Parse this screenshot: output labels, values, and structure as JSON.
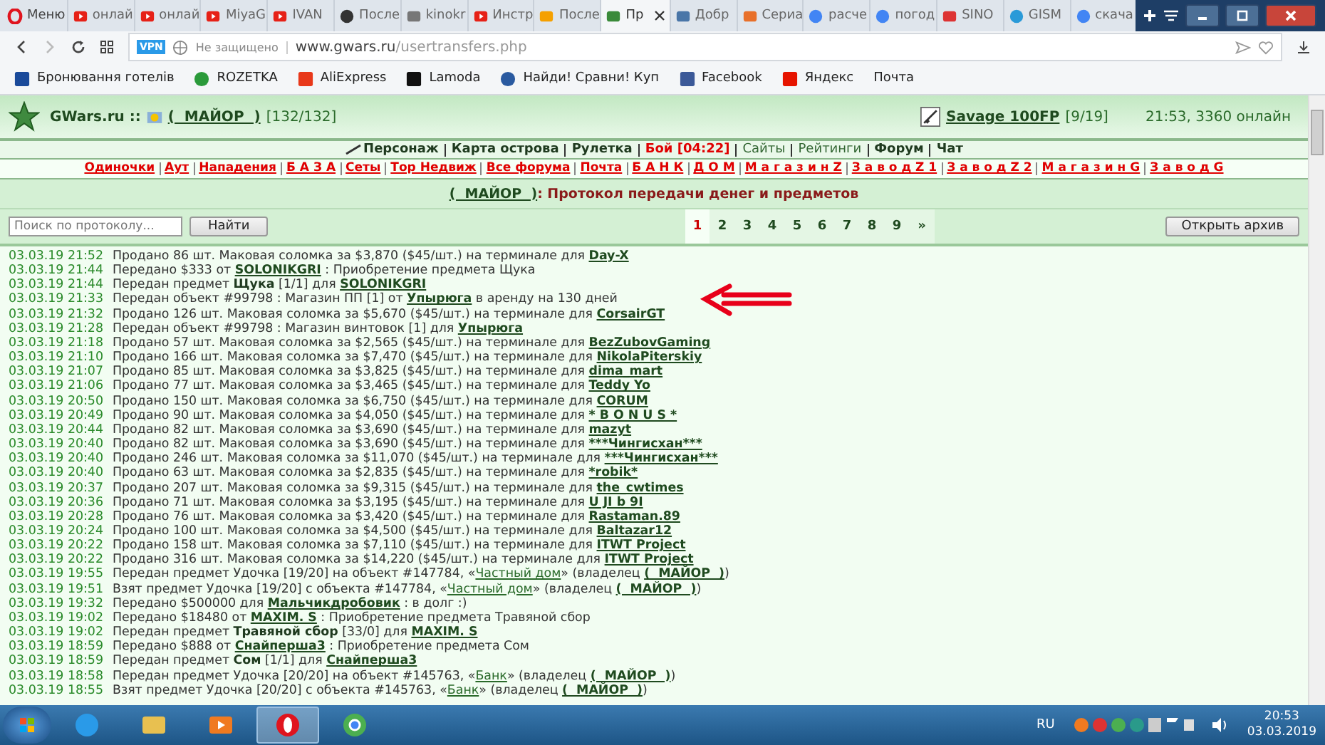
{
  "browser": {
    "menu": "Меню",
    "tabs": [
      {
        "label": "онлай",
        "selected": false
      },
      {
        "label": "онлай",
        "selected": false
      },
      {
        "label": "MiyaG",
        "selected": false
      },
      {
        "label": "IVAN",
        "selected": false
      },
      {
        "label": "После",
        "selected": false
      },
      {
        "label": "kinokr",
        "selected": false
      },
      {
        "label": "Инстр",
        "selected": false
      },
      {
        "label": "После",
        "selected": false
      },
      {
        "label": "Пр",
        "selected": true
      },
      {
        "label": "Добр",
        "selected": false
      },
      {
        "label": "Сериа",
        "selected": false
      },
      {
        "label": "расче",
        "selected": false
      },
      {
        "label": "погод",
        "selected": false
      },
      {
        "label": "SINO",
        "selected": false
      },
      {
        "label": "GISM",
        "selected": false
      },
      {
        "label": "скача",
        "selected": false
      }
    ],
    "vpn": "VPN",
    "security": "Не защищено",
    "url_host": "www.gwars.ru",
    "url_path": "/usertransfers.php",
    "bookmarks": [
      "Бронювання готелів",
      "ROZETKA",
      "AliExpress",
      "Lamoda",
      "Найди! Сравни! Куп",
      "Facebook",
      "Яндекс",
      "Почта"
    ]
  },
  "header": {
    "site": "GWars.ru ::",
    "player": "(  МАЙОР  )",
    "hp": "[132/132]",
    "weapon": "Savage 100FP",
    "ammo": "[9/19]",
    "status": "21:53, 3360 онлайн"
  },
  "nav": [
    {
      "label": "Персонаж",
      "kind": "bold"
    },
    {
      "label": "Карта острова",
      "kind": "bold"
    },
    {
      "label": "Рулетка",
      "kind": "bold"
    },
    {
      "label": "Бой [04:22]",
      "kind": "alert"
    },
    {
      "label": "Сайты",
      "kind": "plain"
    },
    {
      "label": "Рейтинги",
      "kind": "plain"
    },
    {
      "label": "Форум",
      "kind": "bold"
    },
    {
      "label": "Чат",
      "kind": "bold"
    }
  ],
  "subnav": [
    "Одиночки",
    "Аут",
    "Нападения",
    "Б А З А",
    "Сеты",
    "Тор Недвиж",
    "Все форума",
    "Почта",
    "Б А Н К",
    "Д О М",
    "М а г а з и н Z",
    "З а в о д Z 1",
    "З а в о д Z 2",
    "М а г а з и н G",
    "З а в о д G"
  ],
  "title": {
    "player": "(  МАЙОР  )",
    "text": ": Протокол передачи денег и предметов"
  },
  "search": {
    "placeholder": "Поиск по протоколу...",
    "button": "Найти"
  },
  "pages": [
    {
      "label": "1",
      "selected": true
    },
    {
      "label": "2",
      "selected": false
    },
    {
      "label": "3",
      "selected": false
    },
    {
      "label": "4",
      "selected": false
    },
    {
      "label": "5",
      "selected": false
    },
    {
      "label": "6",
      "selected": false
    },
    {
      "label": "7",
      "selected": false
    },
    {
      "label": "8",
      "selected": false
    },
    {
      "label": "9",
      "selected": false
    },
    {
      "label": "»",
      "selected": false
    }
  ],
  "archive_button": "Открыть архив",
  "log": [
    {
      "date": "03.03.19 21:52",
      "parts": [
        {
          "kind": "text",
          "text": "Продано 86 шт. Маковая соломка за $3,870 ($45/шт.) на терминале для "
        },
        {
          "kind": "link",
          "text": "Day-X"
        }
      ]
    },
    {
      "date": "03.03.19 21:44",
      "parts": [
        {
          "kind": "text",
          "text": "Передано $333 от "
        },
        {
          "kind": "link",
          "text": "SOLONIKGRI"
        },
        {
          "kind": "text",
          "text": " : Приобретение предмета Щука"
        }
      ]
    },
    {
      "date": "03.03.19 21:44",
      "parts": [
        {
          "kind": "text",
          "text": "Передан предмет "
        },
        {
          "kind": "bold",
          "text": "Щука"
        },
        {
          "kind": "text",
          "text": " [1/1] для "
        },
        {
          "kind": "link",
          "text": "SOLONIKGRI"
        }
      ]
    },
    {
      "date": "03.03.19 21:33",
      "parts": [
        {
          "kind": "text",
          "text": "Передан объект #99798 : Магазин ПП [1] от "
        },
        {
          "kind": "link",
          "text": "Упырюга"
        },
        {
          "kind": "text",
          "text": " в аренду на 130 дней"
        }
      ]
    },
    {
      "date": "03.03.19 21:32",
      "parts": [
        {
          "kind": "text",
          "text": "Продано 126 шт. Маковая соломка за $5,670 ($45/шт.) на терминале для "
        },
        {
          "kind": "link",
          "text": "CorsairGT"
        }
      ]
    },
    {
      "date": "03.03.19 21:28",
      "parts": [
        {
          "kind": "text",
          "text": "Передан объект #99798 : Магазин винтовок [1] для "
        },
        {
          "kind": "link",
          "text": "Упырюга"
        }
      ]
    },
    {
      "date": "03.03.19 21:18",
      "parts": [
        {
          "kind": "text",
          "text": "Продано 57 шт. Маковая соломка за $2,565 ($45/шт.) на терминале для "
        },
        {
          "kind": "link",
          "text": "BezZubovGaming"
        }
      ]
    },
    {
      "date": "03.03.19 21:10",
      "parts": [
        {
          "kind": "text",
          "text": "Продано 166 шт. Маковая соломка за $7,470 ($45/шт.) на терминале для "
        },
        {
          "kind": "link",
          "text": "NikolaPiterskiy"
        }
      ]
    },
    {
      "date": "03.03.19 21:07",
      "parts": [
        {
          "kind": "text",
          "text": "Продано 85 шт. Маковая соломка за $3,825 ($45/шт.) на терминале для "
        },
        {
          "kind": "link",
          "text": "dima_mart"
        }
      ]
    },
    {
      "date": "03.03.19 21:06",
      "parts": [
        {
          "kind": "text",
          "text": "Продано 77 шт. Маковая соломка за $3,465 ($45/шт.) на терминале для "
        },
        {
          "kind": "link",
          "text": "Teddy Yo"
        }
      ]
    },
    {
      "date": "03.03.19 20:50",
      "parts": [
        {
          "kind": "text",
          "text": "Продано 150 шт. Маковая соломка за $6,750 ($45/шт.) на терминале для "
        },
        {
          "kind": "link",
          "text": "CORUM"
        }
      ]
    },
    {
      "date": "03.03.19 20:49",
      "parts": [
        {
          "kind": "text",
          "text": "Продано 90 шт. Маковая соломка за $4,050 ($45/шт.) на терминале для "
        },
        {
          "kind": "link",
          "text": "* B O N U S *"
        }
      ]
    },
    {
      "date": "03.03.19 20:44",
      "parts": [
        {
          "kind": "text",
          "text": "Продано 82 шт. Маковая соломка за $3,690 ($45/шт.) на терминале для "
        },
        {
          "kind": "link",
          "text": "mazyt"
        }
      ]
    },
    {
      "date": "03.03.19 20:40",
      "parts": [
        {
          "kind": "text",
          "text": "Продано 82 шт. Маковая соломка за $3,690 ($45/шт.) на терминале для "
        },
        {
          "kind": "link",
          "text": "***Чингисхан***"
        }
      ]
    },
    {
      "date": "03.03.19 20:40",
      "parts": [
        {
          "kind": "text",
          "text": "Продано 246 шт. Маковая соломка за $11,070 ($45/шт.) на терминале для "
        },
        {
          "kind": "link",
          "text": "***Чингисхан***"
        }
      ]
    },
    {
      "date": "03.03.19 20:40",
      "parts": [
        {
          "kind": "text",
          "text": "Продано 63 шт. Маковая соломка за $2,835 ($45/шт.) на терминале для "
        },
        {
          "kind": "link",
          "text": "*robik*"
        }
      ]
    },
    {
      "date": "03.03.19 20:37",
      "parts": [
        {
          "kind": "text",
          "text": "Продано 207 шт. Маковая соломка за $9,315 ($45/шт.) на терминале для "
        },
        {
          "kind": "link",
          "text": "the_cwtimes"
        }
      ]
    },
    {
      "date": "03.03.19 20:36",
      "parts": [
        {
          "kind": "text",
          "text": "Продано 71 шт. Маковая соломка за $3,195 ($45/шт.) на терминале для "
        },
        {
          "kind": "link",
          "text": "U JI b 9I"
        }
      ]
    },
    {
      "date": "03.03.19 20:28",
      "parts": [
        {
          "kind": "text",
          "text": "Продано 76 шт. Маковая соломка за $3,420 ($45/шт.) на терминале для "
        },
        {
          "kind": "link",
          "text": "Rastaman.89"
        }
      ]
    },
    {
      "date": "03.03.19 20:24",
      "parts": [
        {
          "kind": "text",
          "text": "Продано 100 шт. Маковая соломка за $4,500 ($45/шт.) на терминале для "
        },
        {
          "kind": "link",
          "text": "Baltazar12"
        }
      ]
    },
    {
      "date": "03.03.19 20:22",
      "parts": [
        {
          "kind": "text",
          "text": "Продано 158 шт. Маковая соломка за $7,110 ($45/шт.) на терминале для "
        },
        {
          "kind": "link",
          "text": "ITWT Project"
        }
      ]
    },
    {
      "date": "03.03.19 20:22",
      "parts": [
        {
          "kind": "text",
          "text": "Продано 316 шт. Маковая соломка за $14,220 ($45/шт.) на терминале для "
        },
        {
          "kind": "link",
          "text": "ITWT Project"
        }
      ]
    },
    {
      "date": "03.03.19 19:55",
      "parts": [
        {
          "kind": "text",
          "text": "Передан предмет Удочка [19/20] на объект #147784, «"
        },
        {
          "kind": "object",
          "text": "Частный дом"
        },
        {
          "kind": "text",
          "text": "» (владелец "
        },
        {
          "kind": "link",
          "text": "(  МАЙОР  )"
        },
        {
          "kind": "text",
          "text": ")"
        }
      ]
    },
    {
      "date": "03.03.19 19:51",
      "parts": [
        {
          "kind": "text",
          "text": "Взят предмет Удочка [19/20] с объекта #147784, «"
        },
        {
          "kind": "object",
          "text": "Частный дом"
        },
        {
          "kind": "text",
          "text": "» (владелец "
        },
        {
          "kind": "link",
          "text": "(  МАЙОР  )"
        },
        {
          "kind": "text",
          "text": ")"
        }
      ]
    },
    {
      "date": "03.03.19 19:32",
      "parts": [
        {
          "kind": "text",
          "text": "Передано $500000 для "
        },
        {
          "kind": "link",
          "text": "Мальчикдробовик"
        },
        {
          "kind": "text",
          "text": " : в долг :)"
        }
      ]
    },
    {
      "date": "03.03.19 19:02",
      "parts": [
        {
          "kind": "text",
          "text": "Передано $18480 от "
        },
        {
          "kind": "link",
          "text": "MAXIM. S"
        },
        {
          "kind": "text",
          "text": " : Приобретение предмета Травяной сбор"
        }
      ]
    },
    {
      "date": "03.03.19 19:02",
      "parts": [
        {
          "kind": "text",
          "text": "Передан предмет "
        },
        {
          "kind": "bold",
          "text": "Травяной сбор"
        },
        {
          "kind": "text",
          "text": " [33/0] для "
        },
        {
          "kind": "link",
          "text": "MAXIM. S"
        }
      ]
    },
    {
      "date": "03.03.19 18:59",
      "parts": [
        {
          "kind": "text",
          "text": "Передано $888 от "
        },
        {
          "kind": "link",
          "text": "Снайперша3"
        },
        {
          "kind": "text",
          "text": " : Приобретение предмета Сом"
        }
      ]
    },
    {
      "date": "03.03.19 18:59",
      "parts": [
        {
          "kind": "text",
          "text": "Передан предмет "
        },
        {
          "kind": "bold",
          "text": "Сом"
        },
        {
          "kind": "text",
          "text": " [1/1] для "
        },
        {
          "kind": "link",
          "text": "Снайперша3"
        }
      ]
    },
    {
      "date": "03.03.19 18:58",
      "parts": [
        {
          "kind": "text",
          "text": "Передан предмет Удочка [20/20] на объект #145763, «"
        },
        {
          "kind": "object",
          "text": "Банк"
        },
        {
          "kind": "text",
          "text": "» (владелец "
        },
        {
          "kind": "link",
          "text": "(  МАЙОР  )"
        },
        {
          "kind": "text",
          "text": ")"
        }
      ]
    },
    {
      "date": "03.03.19 18:55",
      "parts": [
        {
          "kind": "text",
          "text": "Взят предмет Удочка [20/20] с объекта #145763, «"
        },
        {
          "kind": "object",
          "text": "Банк"
        },
        {
          "kind": "text",
          "text": "» (владелец "
        },
        {
          "kind": "link",
          "text": "(  МАЙОР  )"
        },
        {
          "kind": "text",
          "text": ")"
        }
      ]
    }
  ],
  "taskbar": {
    "apps": [
      {
        "selected": false
      },
      {
        "selected": false
      },
      {
        "selected": false
      },
      {
        "selected": true
      },
      {
        "selected": false
      }
    ],
    "language": "RU",
    "time": "20:53",
    "date": "03.03.2019"
  }
}
